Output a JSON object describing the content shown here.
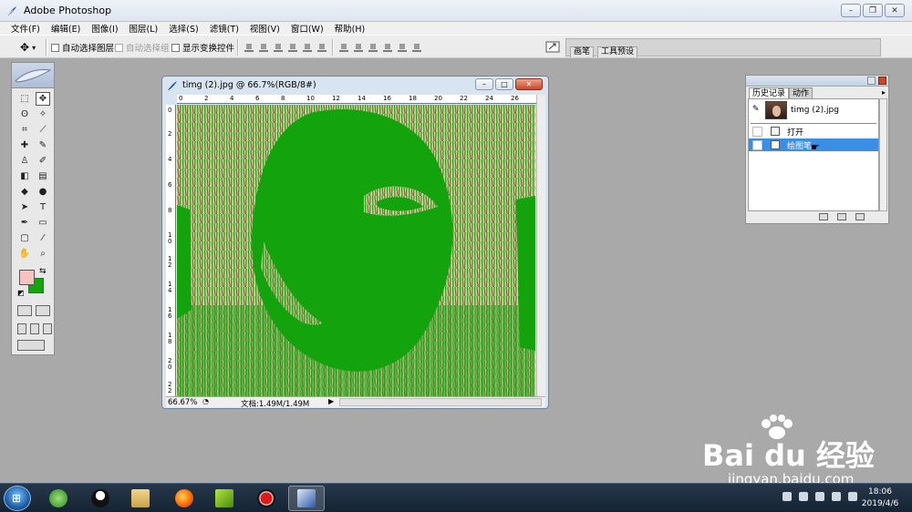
{
  "app": {
    "title": "Adobe Photoshop"
  },
  "menu": [
    "文件(F)",
    "编辑(E)",
    "图像(I)",
    "图层(L)",
    "选择(S)",
    "滤镜(T)",
    "视图(V)",
    "窗口(W)",
    "帮助(H)"
  ],
  "options": {
    "auto_select_layer": "自动选择图层",
    "auto_select_group": "自动选择组",
    "show_transform": "显示变换控件"
  },
  "palette_well": {
    "tab_brushes": "画笔",
    "tab_presets": "工具预设"
  },
  "document": {
    "title": "timg (2).jpg @ 66.7%(RGB/8#)",
    "zoom": "66.67%",
    "doc_size": "文档:1.49M/1.49M",
    "ruler_top": [
      "0",
      "2",
      "4",
      "6",
      "8",
      "10",
      "12",
      "14",
      "16",
      "18",
      "20",
      "22",
      "24",
      "26"
    ],
    "ruler_left": [
      "0",
      "2",
      "4",
      "6",
      "8",
      "1 0",
      "1 2",
      "1 4",
      "1 6",
      "1 8",
      "2 0",
      "2 2"
    ]
  },
  "history": {
    "tab_history": "历史记录",
    "tab_actions": "动作",
    "snapshot": "timg (2).jpg",
    "states": [
      {
        "label": "打开",
        "selected": false
      },
      {
        "label": "绘图笔",
        "selected": true
      }
    ]
  },
  "colors": {
    "foreground": "#f6c3c0",
    "background": "#14a40e",
    "canvas_green": "#13a30c",
    "canvas_peach": "#e9c4a6"
  },
  "watermark": {
    "logo": "Bai du 经验",
    "url": "jingyan.baidu.com"
  },
  "taskbar": {
    "apps": [
      "360-browser",
      "qq",
      "file-explorer",
      "firefox",
      "media-player",
      "recorder",
      "photoshop"
    ],
    "time": "18:06",
    "date": "2019/4/6"
  }
}
